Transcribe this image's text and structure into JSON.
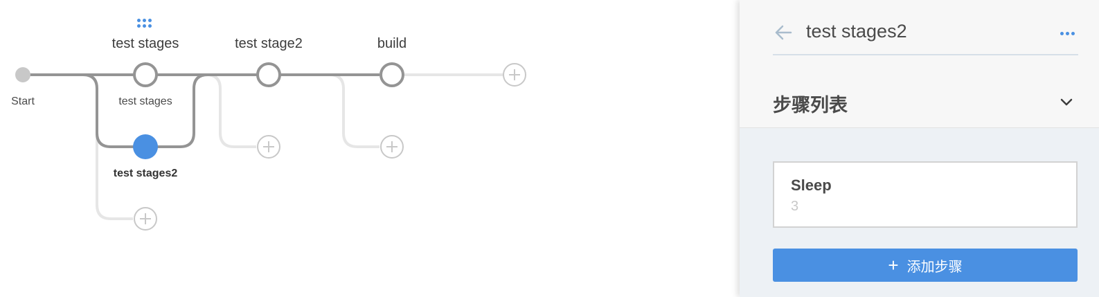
{
  "pipeline": {
    "start_label": "Start",
    "stages": [
      {
        "title": "test stages",
        "node_label": "test stages"
      },
      {
        "title": "test stage2"
      },
      {
        "title": "build"
      }
    ],
    "parallel_node_label": "test stages2",
    "colors": {
      "track": "#949494",
      "track_light": "#e6e6e6",
      "node_selected": "#4a90e2",
      "add_icon": "#c8c8c8"
    }
  },
  "panel": {
    "title": "test stages2",
    "section_title": "步骤列表",
    "steps": [
      {
        "name": "Sleep",
        "arg": "3"
      }
    ],
    "add_step_label": "添加步骤",
    "accent": "#4a90e2"
  }
}
